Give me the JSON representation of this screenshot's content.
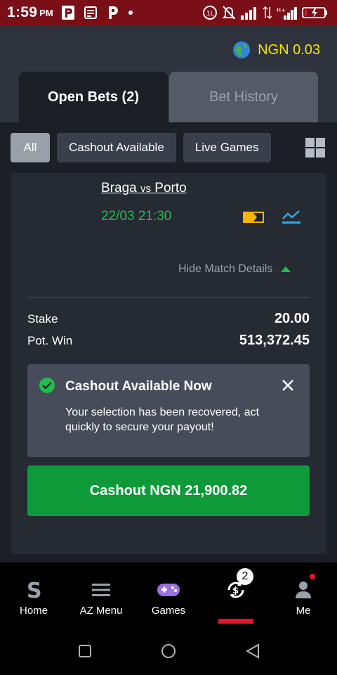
{
  "status_bar": {
    "time": "1:59",
    "ampm": "PM"
  },
  "header": {
    "balance": "NGN 0.03"
  },
  "tabs": {
    "open_bets": "Open Bets (2)",
    "bet_history": "Bet History"
  },
  "filters": {
    "all": "All",
    "cashout": "Cashout Available",
    "live": "Live Games"
  },
  "bet": {
    "home_team": "Braga",
    "vs": "vs",
    "away_team": "Porto",
    "date": "22/03 21:30",
    "hide_details": "Hide Match Details",
    "stake_label": "Stake",
    "stake_value": "20.00",
    "potwin_label": "Pot. Win",
    "potwin_value": "513,372.45"
  },
  "notice": {
    "title": "Cashout Available Now",
    "text": "Your selection has been recovered, act quickly to secure your payout!"
  },
  "cashout_button": "Cashout NGN 21,900.82",
  "nav": {
    "home": "Home",
    "az_menu": "AZ Menu",
    "games": "Games",
    "open_bets_badge": "2",
    "me": "Me"
  },
  "colors": {
    "accent_green": "#0f9a3a",
    "balance_yellow": "#f4e400",
    "status_red": "#7a0f17",
    "active_red": "#e4152a"
  }
}
